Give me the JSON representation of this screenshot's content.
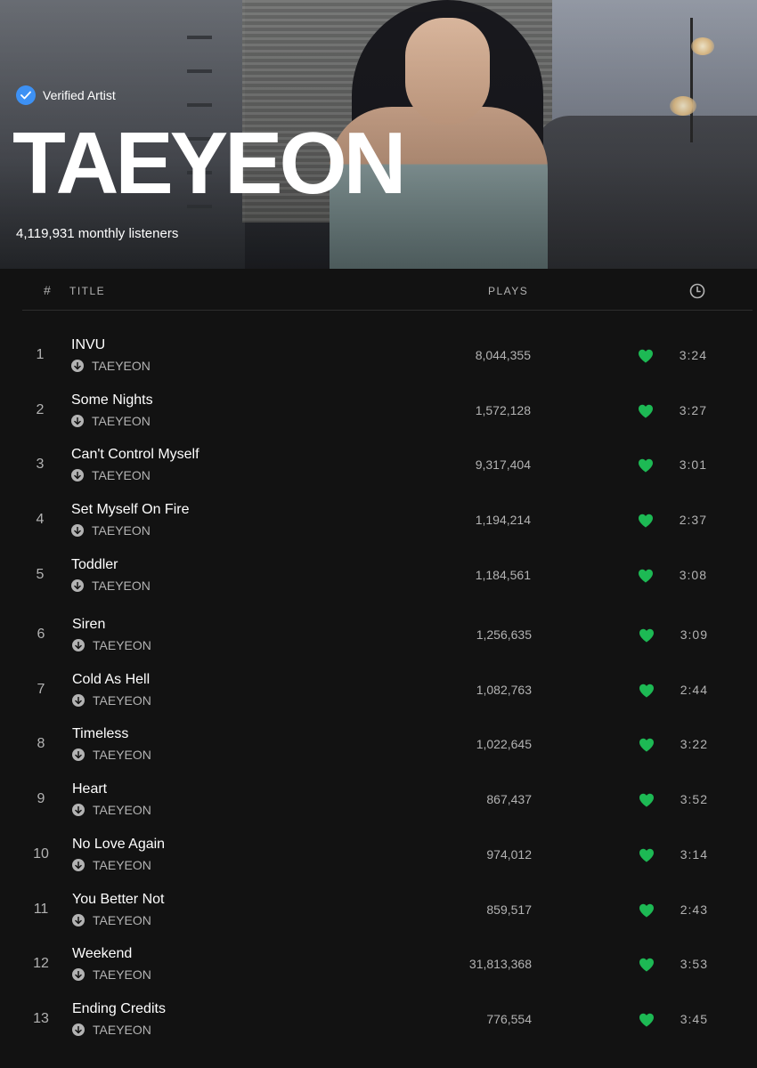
{
  "artist": {
    "verified_label": "Verified Artist",
    "name": "TAEYEON",
    "monthly_listeners": "4,119,931 monthly listeners"
  },
  "table_header": {
    "number": "#",
    "title": "TITLE",
    "plays": "PLAYS",
    "duration_icon": "clock-icon"
  },
  "colors": {
    "background": "#121212",
    "accent_green": "#1db954",
    "verified_blue": "#3d91f4",
    "secondary_text": "#b3b3b3"
  },
  "tracks": [
    {
      "index": "1",
      "title": "INVU",
      "artist": "TAEYEON",
      "plays": "8,044,355",
      "liked": true,
      "duration": "3:24"
    },
    {
      "index": "2",
      "title": "Some Nights",
      "artist": "TAEYEON",
      "plays": "1,572,128",
      "liked": true,
      "duration": "3:27"
    },
    {
      "index": "3",
      "title": "Can't Control Myself",
      "artist": "TAEYEON",
      "plays": "9,317,404",
      "liked": true,
      "duration": "3:01"
    },
    {
      "index": "4",
      "title": "Set Myself On Fire",
      "artist": "TAEYEON",
      "plays": "1,194,214",
      "liked": true,
      "duration": "2:37"
    },
    {
      "index": "5",
      "title": "Toddler",
      "artist": "TAEYEON",
      "plays": "1,184,561",
      "liked": true,
      "duration": "3:08"
    },
    {
      "index": "6",
      "title": "Siren",
      "artist": "TAEYEON",
      "plays": "1,256,635",
      "liked": true,
      "duration": "3:09"
    },
    {
      "index": "7",
      "title": "Cold As Hell",
      "artist": "TAEYEON",
      "plays": "1,082,763",
      "liked": true,
      "duration": "2:44"
    },
    {
      "index": "8",
      "title": "Timeless",
      "artist": "TAEYEON",
      "plays": "1,022,645",
      "liked": true,
      "duration": "3:22"
    },
    {
      "index": "9",
      "title": "Heart",
      "artist": "TAEYEON",
      "plays": "867,437",
      "liked": true,
      "duration": "3:52"
    },
    {
      "index": "10",
      "title": "No Love Again",
      "artist": "TAEYEON",
      "plays": "974,012",
      "liked": true,
      "duration": "3:14"
    },
    {
      "index": "11",
      "title": "You Better Not",
      "artist": "TAEYEON",
      "plays": "859,517",
      "liked": true,
      "duration": "2:43"
    },
    {
      "index": "12",
      "title": "Weekend",
      "artist": "TAEYEON",
      "plays": "31,813,368",
      "liked": true,
      "duration": "3:53"
    },
    {
      "index": "13",
      "title": "Ending Credits",
      "artist": "TAEYEON",
      "plays": "776,554",
      "liked": true,
      "duration": "3:45"
    }
  ]
}
